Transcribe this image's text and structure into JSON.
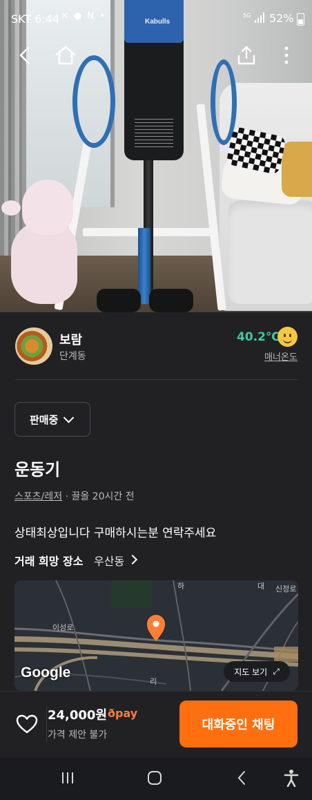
{
  "status_bar": {
    "time": "SKT 6:44",
    "left_icons": "✕ ● N •",
    "right_icons": "5G",
    "battery": "52%"
  },
  "photo": {
    "brand": "Kabulls"
  },
  "nav": {
    "back_icon": "back-arrow",
    "home_icon": "home",
    "share_icon": "share",
    "more_icon": "more-vertical"
  },
  "seller": {
    "name": "보람",
    "area": "단계동",
    "temperature": "40.2℃",
    "manner_label": "매너온도",
    "temperature_color": "#3ec9a1"
  },
  "sale_status": {
    "selected": "판매중"
  },
  "product": {
    "title": "운동기",
    "category": "스포츠/레저",
    "meta_suffix": " · 끌올 20시간 전",
    "description": "상태최상입니다 구매하시는분 연락주세요"
  },
  "place": {
    "label": "거래 희망 장소",
    "value": "우산동"
  },
  "map": {
    "google": "Google",
    "view_button": "지도 보기",
    "labels": [
      "이성로",
      "하",
      "대",
      "신정로",
      "리"
    ]
  },
  "bottom": {
    "price": "24,000원",
    "pay": "pay",
    "negotiation": "가격 제안 불가",
    "chat_button": "대화중인 채팅",
    "accent": "#ff6f0f"
  },
  "system_nav": {
    "recents": "|||",
    "home": "▢",
    "back": "<",
    "accessibility": "accessibility"
  }
}
